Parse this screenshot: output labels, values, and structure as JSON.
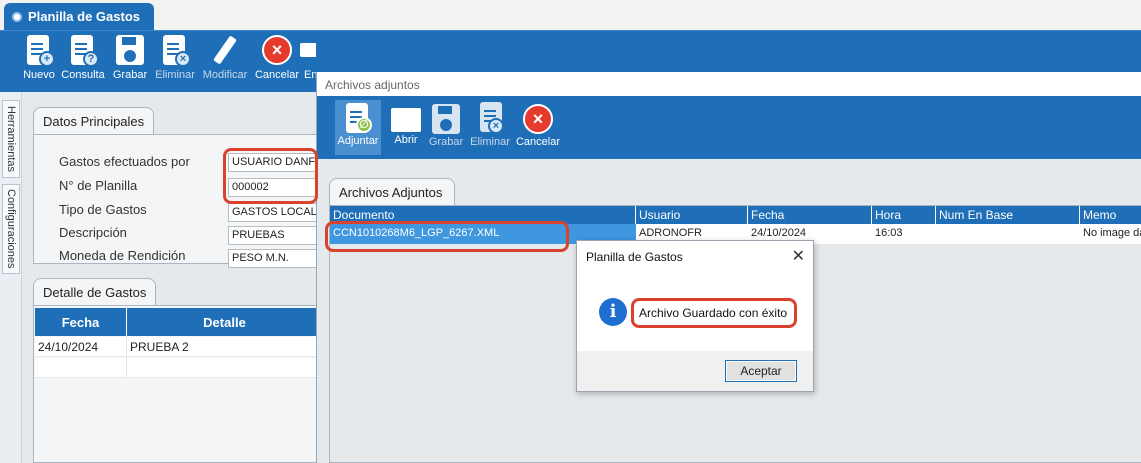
{
  "app": {
    "tab_title": "Planilla de Gastos"
  },
  "toolbar": {
    "items": [
      {
        "label": "Nuevo",
        "icon": "new-document-icon"
      },
      {
        "label": "Consulta",
        "icon": "query-document-icon"
      },
      {
        "label": "Grabar",
        "icon": "save-icon"
      },
      {
        "label": "Eliminar",
        "icon": "delete-document-icon"
      },
      {
        "label": "Modificar",
        "icon": "edit-icon"
      },
      {
        "label": "Cancelar",
        "icon": "cancel-icon"
      },
      {
        "label": "En",
        "icon": "send-mail-icon"
      }
    ]
  },
  "side_tabs": {
    "tools": "Herramientas",
    "config": "Configuraciones"
  },
  "datos": {
    "tab_label": "Datos Principales",
    "fields": [
      {
        "label": "Gastos efectuados por",
        "value": "USUARIO DANFIC"
      },
      {
        "label": "N° de Planilla",
        "value": "000002"
      },
      {
        "label": "Tipo de Gastos",
        "value": "GASTOS LOCALES"
      },
      {
        "label": "Descripción",
        "value": "PRUEBAS"
      },
      {
        "label": "Moneda de Rendición",
        "value": "PESO M.N."
      }
    ]
  },
  "detalle": {
    "tab_label": "Detalle de Gastos",
    "headers": [
      "Fecha",
      "Detalle"
    ],
    "rows": [
      {
        "fecha": "24/10/2024",
        "detalle": "PRUEBA 2"
      }
    ]
  },
  "attachments": {
    "window_title": "Archivos adjuntos",
    "toolbar": [
      {
        "label": "Adjuntar",
        "icon": "attach-icon"
      },
      {
        "label": "Abrir",
        "icon": "folder-open-icon"
      },
      {
        "label": "Grabar",
        "icon": "save-icon"
      },
      {
        "label": "Eliminar",
        "icon": "delete-document-icon"
      },
      {
        "label": "Cancelar",
        "icon": "cancel-icon"
      }
    ],
    "tab_label": "Archivos Adjuntos",
    "columns": [
      "Documento",
      "Usuario",
      "Fecha",
      "Hora",
      "Num En Base",
      "Memo"
    ],
    "row": {
      "documento": "CCN1010268M6_LGP_6267.XML",
      "usuario": "ADRONOFR",
      "fecha": "24/10/2024",
      "hora": "16:03",
      "num_en_base": "",
      "memo": "No image da"
    }
  },
  "dialog": {
    "title": "Planilla de Gastos",
    "message": "Archivo Guardado con éxito",
    "button": "Aceptar",
    "icon": "info-icon"
  },
  "colors": {
    "brand_blue": "#1f6fb8",
    "highlight_red": "#d9432e"
  }
}
